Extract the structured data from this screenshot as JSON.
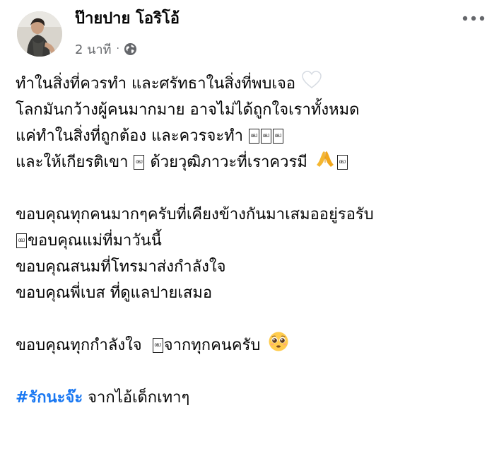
{
  "post": {
    "author": "ป๊ายปาย โอริโอ้",
    "time": "2 นาที",
    "dot": "·",
    "privacy_icon": "globe-icon",
    "more_icon": "more-options-icon",
    "lines": [
      "ทำในสิ่งที่ควรทำ  และศรัทธาในสิ่งที่พบเจอ",
      "โลกมันกว้างผู้คนมากมาย อาจไม่ได้ถูกใจเราทั้งหมด",
      "แค่ทำในสิ่งที่ถูกต้อง และควรจะทำ ",
      "และให้เกียรติเขา ",
      " ด้วยวุฒิภาวะที่เราควรมี ",
      "ขอบคุณทุกคนมากๆครับที่เคียงข้างกันมาเสมออยู่รอรับ",
      "ขอบคุณแม่ที่มาวันนี้",
      "ขอบคุณสนมที่โทรมาส่งกำลังใจ",
      "ขอบคุณพี่เบส ที่ดูแลปายเสมอ",
      "ขอบคุณทุกกำลังใจ  ",
      "จากทุกคนครับ "
    ],
    "obj_glyph": "OBJ",
    "hashtag": "#รักนะจ๊ะ",
    "hashtag_suffix": " จากไอ้เด็กเทาๆ"
  },
  "colors": {
    "text": "#050505",
    "meta": "#65676b",
    "link": "#1877f2"
  }
}
